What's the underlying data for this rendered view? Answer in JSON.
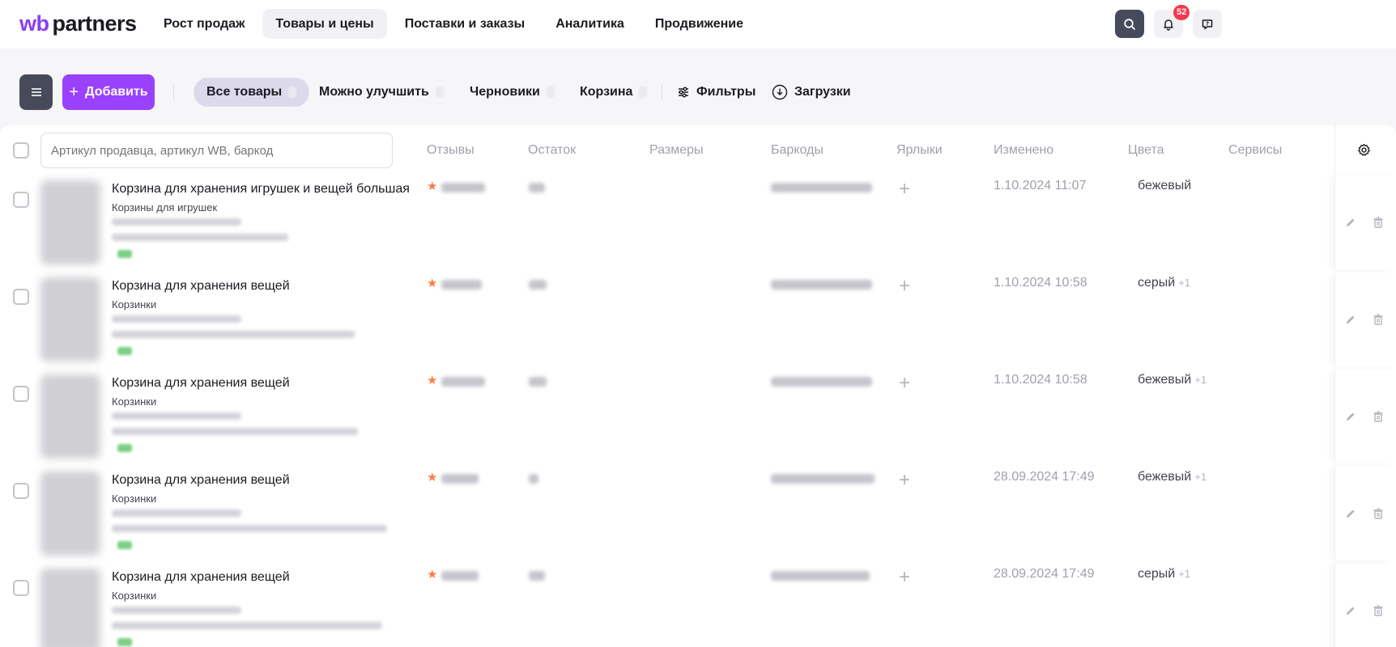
{
  "brand": {
    "wb": "wb",
    "partners": "partners"
  },
  "nav": [
    {
      "label": "Рост продаж",
      "active": false
    },
    {
      "label": "Товары и цены",
      "active": true
    },
    {
      "label": "Поставки и заказы",
      "active": false
    },
    {
      "label": "Аналитика",
      "active": false
    },
    {
      "label": "Продвижение",
      "active": false
    }
  ],
  "header_icons": {
    "search": "search-icon",
    "bell": "bell-icon",
    "chat": "chat-icon",
    "notifications_count": "52"
  },
  "toolbar": {
    "menu_icon": "menu-icon",
    "add_label": "Добавить",
    "tabs": [
      {
        "label": "Все товары",
        "active": true
      },
      {
        "label": "Можно улучшить",
        "active": false
      },
      {
        "label": "Черновики",
        "active": false
      },
      {
        "label": "Корзина",
        "active": false
      }
    ],
    "filters_label": "Фильтры",
    "downloads_label": "Загрузки"
  },
  "table": {
    "search_placeholder": "Артикул продавца, артикул WB, баркод",
    "columns": [
      "Отзывы",
      "Остаток",
      "Размеры",
      "Баркоды",
      "Ярлыки",
      "Изменено",
      "Цвета",
      "Сервисы"
    ],
    "rows": [
      {
        "title": "Корзина для хранения игрушек и вещей большая",
        "subject": "Корзины для игрушек",
        "modified": "1.10.2024 11:07",
        "color": "бежевый",
        "more_colors": ""
      },
      {
        "title": "Корзина для хранения вещей",
        "subject": "Корзинки",
        "modified": "1.10.2024 10:58",
        "color": "серый",
        "more_colors": "+1"
      },
      {
        "title": "Корзина для хранения вещей",
        "subject": "Корзинки",
        "modified": "1.10.2024 10:58",
        "color": "бежевый",
        "more_colors": "+1"
      },
      {
        "title": "Корзина для хранения вещей",
        "subject": "Корзинки",
        "modified": "28.09.2024 17:49",
        "color": "бежевый",
        "more_colors": "+1"
      },
      {
        "title": "Корзина для хранения вещей",
        "subject": "Корзинки",
        "modified": "28.09.2024 17:49",
        "color": "серый",
        "more_colors": "+1"
      }
    ]
  },
  "colors": {
    "accent": "#9a41fe",
    "dark_button": "#464a5a",
    "badge": "#f5394c",
    "star": "#ff7a45"
  }
}
